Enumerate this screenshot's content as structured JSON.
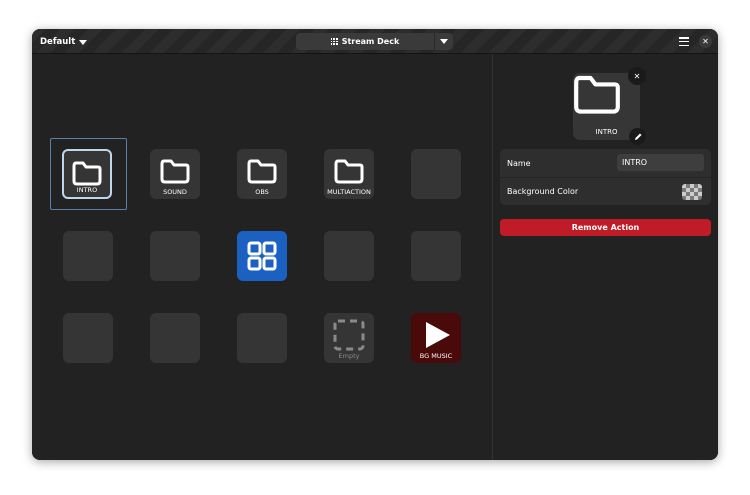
{
  "header": {
    "profile": "Default",
    "device": "Stream Deck"
  },
  "colors": {
    "accent_blue": "#1c60c2",
    "destructive": "#c01c28",
    "play_bg": "#4a0a0a",
    "selected_border": "#c0d6ec"
  },
  "grid": {
    "keys": [
      {
        "label": "INTRO",
        "icon": "folder-icon",
        "selected": true
      },
      {
        "label": "SOUND",
        "icon": "folder-icon"
      },
      {
        "label": "OBS",
        "icon": "folder-icon"
      },
      {
        "label": "MULTIACTION",
        "icon": "folder-icon"
      },
      {
        "label": "",
        "icon": ""
      },
      {
        "label": "",
        "icon": ""
      },
      {
        "label": "",
        "icon": ""
      },
      {
        "label": "",
        "icon": "grid-apps-icon"
      },
      {
        "label": "",
        "icon": ""
      },
      {
        "label": "",
        "icon": ""
      },
      {
        "label": "",
        "icon": ""
      },
      {
        "label": "",
        "icon": ""
      },
      {
        "label": "",
        "icon": ""
      },
      {
        "label": "Empty",
        "icon": "dashed-square-icon"
      },
      {
        "label": "BG MUSIC",
        "icon": "play-icon"
      }
    ]
  },
  "inspector": {
    "preview_label": "INTRO",
    "name_label": "Name",
    "name_value": "INTRO",
    "bg_color_label": "Background Color",
    "remove_label": "Remove Action"
  }
}
